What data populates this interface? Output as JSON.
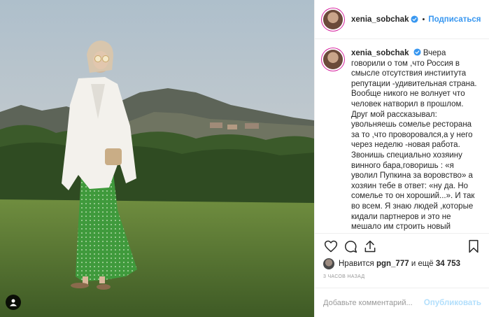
{
  "header": {
    "username": "xenia_sobchak",
    "separator": "•",
    "follow_label": "Подписаться"
  },
  "caption": {
    "username": "xenia_sobchak",
    "text": "Вчера говорили о том ,что Россия в смысле отсутствия инстиитута репутации -удивительная страна. Вообще никого не волнует что человек натворил в прошлом. Друг мой рассказывал: увольняешь сомелье ресторана за то ,что проворовался,а у него через неделю -новая работа. Звонишь специально хозяину винного бара,говоришь : «я уволил Пупкина за воровство» а хозяин тебе в ответ: «ну да. Но сомелье то он хороший...». И так во всем. Я знаю людей ,которые кидали партнеров и это не мешало им строить новый бизнес. знаю тех,кто публично признавался аферистом и сидел за мошенничество ,но потом опять"
  },
  "likes": {
    "prefix": "Нравится",
    "user": "pgn_777",
    "middle": "и ещё",
    "count": "34 753"
  },
  "timestamp": "3 часов назад",
  "comment": {
    "placeholder": "Добавьте комментарий...",
    "publish_label": "Опубликовать"
  },
  "icons": {
    "like": "heart-icon",
    "comment": "comment-icon",
    "share": "share-icon",
    "save": "bookmark-icon",
    "verified": "verified-badge-icon",
    "tags": "user-tag-icon"
  },
  "colors": {
    "link_blue": "#3897f0",
    "publish_disabled": "#b2dffc",
    "verified_blue": "#3897f0",
    "text": "#262626",
    "muted": "#999999"
  }
}
